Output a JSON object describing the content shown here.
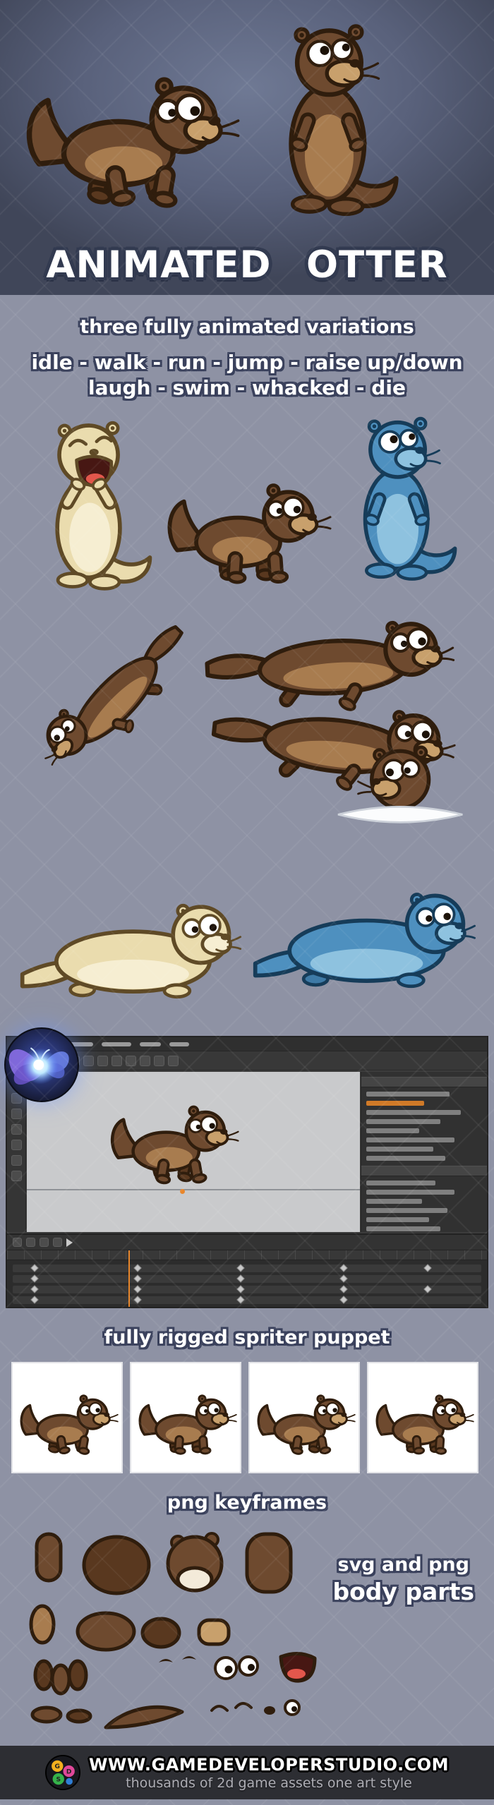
{
  "title": "ANIMATED OTTER",
  "variations": {
    "heading": "three fully animated variations",
    "animations_line1": "idle - walk - run - jump - raise up/down",
    "animations_line2": "laugh - swim - whacked - die"
  },
  "captions": {
    "spriter": "fully rigged spriter puppet",
    "keyframes": "png keyframes",
    "parts_line1": "svg and png",
    "parts_line2": "body parts"
  },
  "footer": {
    "url": "WWW.GAMEDEVELOPERSTUDIO.COM",
    "tagline": "thousands of 2d game assets one art style",
    "logo_letters": [
      "G",
      "D",
      "S"
    ]
  },
  "colors": {
    "hero_bg_center": "#6f7994",
    "hero_bg_edge": "#404659",
    "page_bg": "#8e92a4",
    "footer_bg": "#2d2e33",
    "text_fill": "#ffffff",
    "text_outline": "#3a415c",
    "spriter_accent_orange": "#d07a28",
    "water_splash": "#fbfcfd",
    "palettes": {
      "brown": {
        "base": "#6e4a2f",
        "dark": "#59381f",
        "belly": "#a87c4f",
        "muzzle": "#c8a06c",
        "outline": "#2f1d0d"
      },
      "cream": {
        "base": "#eadcae",
        "dark": "#d9c48e",
        "belly": "#f6eed2",
        "muzzle": "#f6eed2",
        "outline": "#5f4a26"
      },
      "blue": {
        "base": "#4e90bf",
        "dark": "#3e7aa6",
        "belly": "#8ec2df",
        "muzzle": "#8ec2df",
        "outline": "#163c59"
      }
    }
  }
}
